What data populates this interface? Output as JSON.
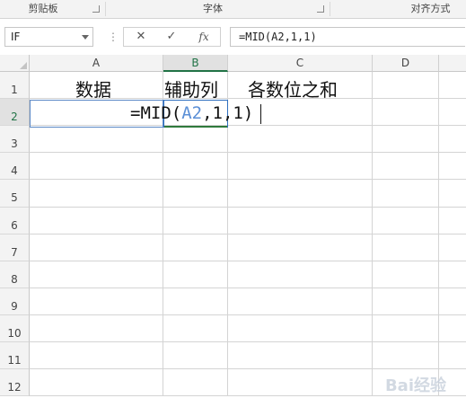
{
  "ribbon": {
    "groups": [
      "剪贴板",
      "字体",
      "对齐方式"
    ]
  },
  "formula_bar": {
    "name_box": "IF",
    "cancel_icon": "✕",
    "enter_icon": "✓",
    "fx_label": "fx",
    "formula": "=MID(A2,1,1)"
  },
  "columns": [
    "A",
    "B",
    "C",
    "D"
  ],
  "rows": [
    "1",
    "2",
    "3",
    "4",
    "5",
    "6",
    "7",
    "8",
    "9",
    "10",
    "11",
    "12"
  ],
  "cells": {
    "A1": "数据",
    "B1": "辅助列",
    "C1": "各数位之和"
  },
  "editor": {
    "prefix": "=MID(",
    "ref": "A2",
    "suffix": ",1,1)"
  },
  "watermark": "Bai经验",
  "colors": {
    "accent_green": "#217346",
    "ref_blue": "#5b8fd6",
    "selection_border": "#5b88c6"
  }
}
